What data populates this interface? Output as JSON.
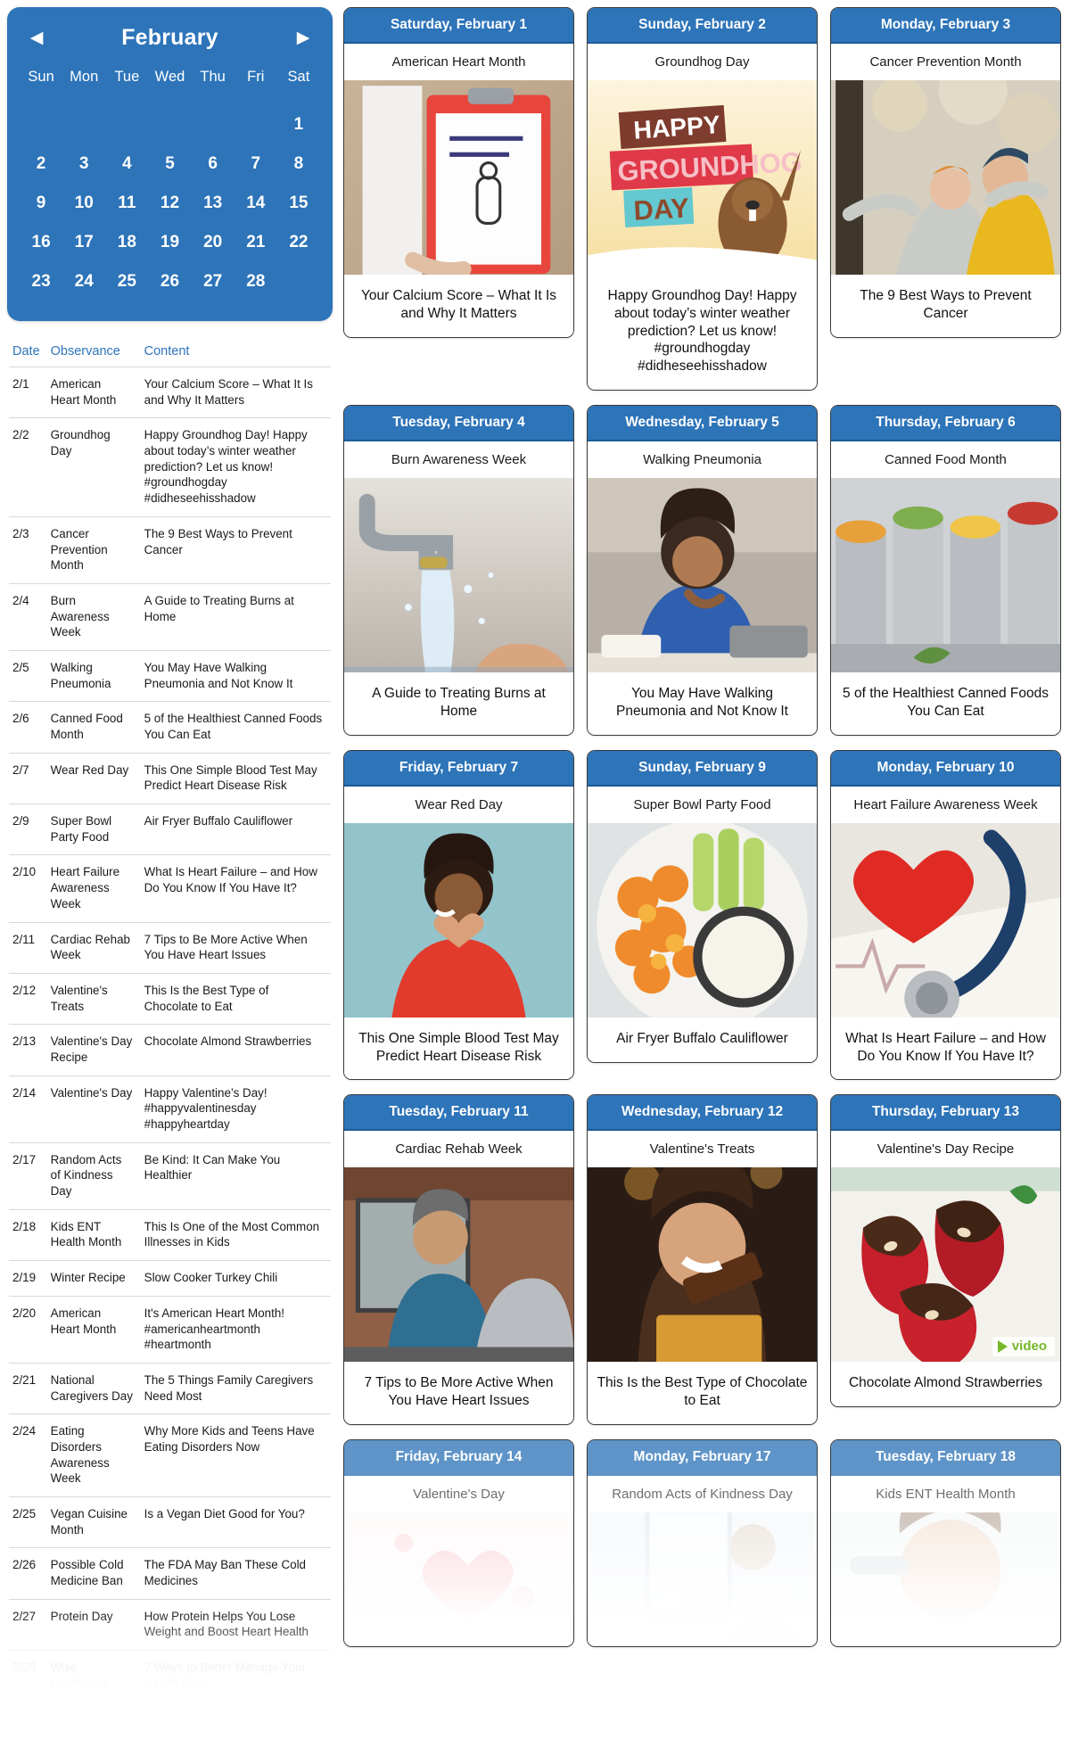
{
  "calendar": {
    "month": "February",
    "prev_icon": "chevron-left-icon",
    "next_icon": "chevron-right-icon",
    "dow": [
      "Sun",
      "Mon",
      "Tue",
      "Wed",
      "Thu",
      "Fri",
      "Sat"
    ],
    "leading_blanks": 6,
    "days": [
      1,
      2,
      3,
      4,
      5,
      6,
      7,
      8,
      9,
      10,
      11,
      12,
      13,
      14,
      15,
      16,
      17,
      18,
      19,
      20,
      21,
      22,
      23,
      24,
      25,
      26,
      27,
      28
    ],
    "accent": "#2d74b9"
  },
  "table": {
    "headers": {
      "date": "Date",
      "observance": "Observance",
      "content": "Content"
    },
    "rows": [
      {
        "date": "2/1",
        "observance": "American Heart Month",
        "content": "Your Calcium Score – What It Is and Why It Matters",
        "faded": false
      },
      {
        "date": "2/2",
        "observance": "Groundhog Day",
        "content": "Happy Groundhog Day! Happy about today’s winter weather prediction? Let us know! #groundhogday #didheseehisshadow",
        "faded": false
      },
      {
        "date": "2/3",
        "observance": "Cancer Prevention Month",
        "content": "The 9 Best Ways to Prevent Cancer",
        "faded": false
      },
      {
        "date": "2/4",
        "observance": "Burn Awareness Week",
        "content": "A Guide to Treating Burns at Home",
        "faded": false
      },
      {
        "date": "2/5",
        "observance": "Walking Pneumonia",
        "content": "You May Have Walking Pneumonia and Not Know It",
        "faded": false
      },
      {
        "date": "2/6",
        "observance": "Canned Food Month",
        "content": "5 of the Healthiest Canned Foods You Can Eat",
        "faded": false
      },
      {
        "date": "2/7",
        "observance": "Wear Red Day",
        "content": "This One Simple Blood Test May Predict Heart Disease Risk",
        "faded": false
      },
      {
        "date": "2/9",
        "observance": "Super Bowl Party Food",
        "content": "Air Fryer Buffalo Cauliflower",
        "faded": false
      },
      {
        "date": "2/10",
        "observance": "Heart Failure Awareness Week",
        "content": "What Is Heart Failure – and How Do You Know If You Have It?",
        "faded": false
      },
      {
        "date": "2/11",
        "observance": "Cardiac Rehab Week",
        "content": "7 Tips to Be More Active When You Have Heart Issues",
        "faded": false
      },
      {
        "date": "2/12",
        "observance": "Valentine's Treats",
        "content": "This Is the Best Type of Chocolate to Eat",
        "faded": false
      },
      {
        "date": "2/13",
        "observance": "Valentine's Day Recipe",
        "content": "Chocolate Almond Strawberries",
        "faded": false
      },
      {
        "date": "2/14",
        "observance": "Valentine's Day",
        "content": "Happy Valentine’s Day! #happyvalentinesday #happyheartday",
        "faded": false
      },
      {
        "date": "2/17",
        "observance": "Random Acts of Kindness Day",
        "content": "Be Kind: It Can Make You Healthier",
        "faded": false
      },
      {
        "date": "2/18",
        "observance": "Kids ENT Health Month",
        "content": "This Is One of the Most Common Illnesses in Kids",
        "faded": false
      },
      {
        "date": "2/19",
        "observance": "Winter Recipe",
        "content": "Slow Cooker Turkey Chili",
        "faded": false
      },
      {
        "date": "2/20",
        "observance": "American Heart Month",
        "content": "It's American Heart Month! #americanheartmonth #heartmonth",
        "faded": false
      },
      {
        "date": "2/21",
        "observance": "National Caregivers Day",
        "content": "The 5 Things Family Caregivers Need Most",
        "faded": false
      },
      {
        "date": "2/24",
        "observance": "Eating Disorders Awareness Week",
        "content": "Why More Kids and Teens Have Eating Disorders Now",
        "faded": false
      },
      {
        "date": "2/25",
        "observance": "Vegan Cuisine Month",
        "content": "Is a Vegan Diet Good for You?",
        "faded": false
      },
      {
        "date": "2/26",
        "observance": "Possible Cold Medicine Ban",
        "content": "The FDA May Ban These Cold Medicines",
        "faded": false
      },
      {
        "date": "2/27",
        "observance": "Protein Day",
        "content": "How Protein Helps You Lose Weight and Boost Heart Health",
        "faded": false
      },
      {
        "date": "2/28",
        "observance": "Wise Healthcare Consumer",
        "content": "7 Ways to Better Manage Your Health Care",
        "faded": true
      }
    ]
  },
  "cards": [
    {
      "date": "Saturday, February 1",
      "observance": "American Heart Month",
      "title": "Your Calcium Score – What It Is and Why It Matters",
      "image": "clipboard-calcium-scoring-photo",
      "video": false,
      "faded": false
    },
    {
      "date": "Sunday, February 2",
      "observance": "Groundhog Day",
      "title": "Happy Groundhog Day! Happy about today’s winter weather prediction? Let us know! #groundhogday #didheseehisshadow",
      "image": "happy-groundhog-day-illustration",
      "video": false,
      "faded": false
    },
    {
      "date": "Monday, February 3",
      "observance": "Cancer Prevention Month",
      "title": "The 9 Best Ways to Prevent Cancer",
      "image": "happy-senior-couple-outdoors-photo",
      "video": false,
      "faded": false
    },
    {
      "date": "Tuesday, February 4",
      "observance": "Burn Awareness Week",
      "title": "A Guide to Treating Burns at Home",
      "image": "running-faucet-water-hand-photo",
      "video": false,
      "faded": false
    },
    {
      "date": "Wednesday, February 5",
      "observance": "Walking Pneumonia",
      "title": "You May Have Walking Pneumonia and Not Know It",
      "image": "woman-coughing-at-desk-photo",
      "video": false,
      "faded": false
    },
    {
      "date": "Thursday, February 6",
      "observance": "Canned Food Month",
      "title": "5 of the Healthiest Canned Foods You Can Eat",
      "image": "open-cans-of-vegetables-photo",
      "video": false,
      "faded": false
    },
    {
      "date": "Friday, February 7",
      "observance": "Wear Red Day",
      "title": "This One Simple Blood Test May Predict Heart Disease Risk",
      "image": "woman-in-red-making-heart-hands-photo",
      "video": false,
      "faded": false
    },
    {
      "date": "Sunday, February 9",
      "observance": "Super Bowl Party Food",
      "title": "Air Fryer Buffalo Cauliflower",
      "image": "buffalo-cauliflower-celery-dip-photo",
      "video": false,
      "faded": false
    },
    {
      "date": "Monday, February 10",
      "observance": "Heart Failure Awareness Week",
      "title": "What Is Heart Failure – and How Do You Know If You Have It?",
      "image": "red-heart-stethoscope-ekg-photo",
      "video": false,
      "faded": false
    },
    {
      "date": "Tuesday, February 11",
      "observance": "Cardiac Rehab Week",
      "title": "7 Tips to Be More Active When You Have Heart Issues",
      "image": "man-on-treadmill-gym-photo",
      "video": false,
      "faded": false
    },
    {
      "date": "Wednesday, February 12",
      "observance": "Valentine's Treats",
      "title": "This Is the Best Type of Chocolate to Eat",
      "image": "woman-eating-chocolate-bar-photo",
      "video": false,
      "faded": false
    },
    {
      "date": "Thursday, February 13",
      "observance": "Valentine's Day Recipe",
      "title": "Chocolate Almond Strawberries",
      "image": "chocolate-almond-strawberries-photo",
      "video": true,
      "faded": false
    },
    {
      "date": "Friday, February 14",
      "observance": "Valentine's Day",
      "title": "",
      "image": "pink-hearts-valentine-photo",
      "video": false,
      "faded": true
    },
    {
      "date": "Monday, February 17",
      "observance": "Random Acts of Kindness Day",
      "title": "",
      "image": "kindness-office-scene-photo",
      "video": false,
      "faded": true
    },
    {
      "date": "Tuesday, February 18",
      "observance": "Kids ENT Health Month",
      "title": "",
      "image": "child-ear-exam-photo",
      "video": false,
      "faded": true
    }
  ],
  "video_badge": {
    "label": "video",
    "color": "#76b82a"
  }
}
